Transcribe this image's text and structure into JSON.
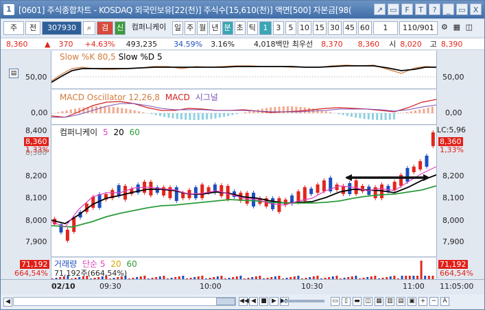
{
  "window": {
    "number": "1",
    "title": "[0601] 주식종합차트 - KOSDAQ 외국인보유[22(천)] 주식수[15,610(천)] 액면[500] 자본금[98(",
    "buttons": [
      "↗",
      "▭",
      "F",
      "T",
      "?",
      "_",
      "▭",
      "X"
    ]
  },
  "toolbar": {
    "market": "주",
    "range": "전",
    "code": "307930",
    "search_icon": "search-icon",
    "check_label": "검",
    "new_label": "신",
    "name": "컴퍼니케이",
    "periods": [
      "일",
      "주",
      "월",
      "년"
    ],
    "bun": "분",
    "cho": "초",
    "tick": "틱",
    "minutes": [
      "1",
      "3",
      "5",
      "10",
      "15",
      "30",
      "45",
      "60"
    ],
    "count_select": "1",
    "page_ratio": "110/901"
  },
  "quote": {
    "price": "8,360",
    "change_arrow": "▲",
    "change": "370",
    "change_pct": "+4.63%",
    "volume": "493,235",
    "turnover_pct": "34.59%",
    "ratio": "3.16%",
    "amount": "4,018백만",
    "best_label": "최우선",
    "best_ask": "8,370",
    "best_bid": "8,360",
    "open_label": "시",
    "open": "8,020",
    "high_label": "고",
    "high": "8,390"
  },
  "stoch": {
    "label_k": "Slow %K 80,5",
    "label_d": "Slow %D 5",
    "ytick": "50,00"
  },
  "macd": {
    "label_osc": "MACD Oscillator 12,26,8",
    "label_macd": "MACD",
    "label_signal": "시그널",
    "ytick": "0,00"
  },
  "price_pane": {
    "legend_name": "컴퍼니케이",
    "legend_ma": [
      "5",
      "20",
      "60"
    ],
    "ticks": [
      "8,400",
      "8,300",
      "8,200",
      "8,100",
      "8,000",
      "7,900"
    ],
    "current": "8,360",
    "current_pct": "1,33%",
    "right_top": "LC:5,96",
    "right_top2": "8,400"
  },
  "volume_pane": {
    "legend": "거래량",
    "ma_label": "단순",
    "ma": [
      "5",
      "20",
      "60"
    ],
    "value_line": "71,192주(664,54%)",
    "value": "71,192",
    "value_pct": "664,54%"
  },
  "xaxis": {
    "date": "02/10",
    "times": [
      "09:30",
      "10:00",
      "10:30",
      "11:00"
    ],
    "cursor_time": "11:05:00"
  },
  "colors": {
    "up": "#e2261c",
    "down": "#1d4fbf",
    "ma5": "#e040c0",
    "ma20": "#000000",
    "ma60": "#2a9a3a"
  }
}
